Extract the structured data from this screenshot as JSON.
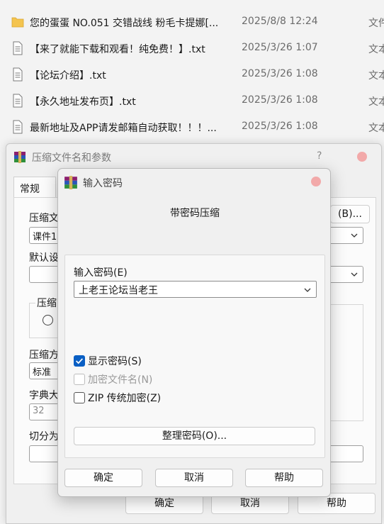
{
  "file_list": [
    {
      "name": "您的蛋蛋 NO.051 交错战线 粉毛卡提娜[...",
      "date": "2025/8/8 12:24",
      "type": "文件",
      "icon": "folder-icon"
    },
    {
      "name": "【来了就能下载和观看！纯免费！】.txt",
      "date": "2025/3/26 1:07",
      "type": "文本",
      "icon": "text-file-icon"
    },
    {
      "name": "【论坛介绍】.txt",
      "date": "2025/3/26 1:08",
      "type": "文本",
      "icon": "text-file-icon"
    },
    {
      "name": "【永久地址发布页】.txt",
      "date": "2025/3/26 1:08",
      "type": "文本",
      "icon": "text-file-icon"
    },
    {
      "name": "最新地址及APP请发邮箱自动获取！！！...",
      "date": "2025/3/26 1:08",
      "type": "文本",
      "icon": "text-file-icon"
    }
  ],
  "back_dialog": {
    "title": "压缩文件名和参数",
    "help_mark": "?",
    "tab": "常规",
    "archive_name_label": "压缩文",
    "browse_button": "(B)...",
    "archive_name_value": "课件1",
    "default_label": "默认设",
    "format_label": "压缩",
    "method_label": "压缩方",
    "method_value": "标准",
    "dict_label": "字典大",
    "dict_value": "32",
    "split_label": "切分为",
    "ok": "确定",
    "cancel": "取消",
    "help": "帮助"
  },
  "password_dialog": {
    "title": "输入密码",
    "caption": "带密码压缩",
    "password_label": "输入密码(E)",
    "password_value": "上老王论坛当老王",
    "show_password": {
      "label": "显示密码(S)",
      "checked": true
    },
    "encrypt_names": {
      "label": "加密文件名(N)",
      "checked": false,
      "disabled": true
    },
    "zip_legacy": {
      "label": "ZIP 传统加密(Z)",
      "checked": false
    },
    "organize_button": "整理密码(O)...",
    "ok": "确定",
    "cancel": "取消",
    "help": "帮助"
  },
  "colors": {
    "accent": "#0a5fc4",
    "close": "#f2a9a9",
    "folder": "#f4c44f"
  }
}
